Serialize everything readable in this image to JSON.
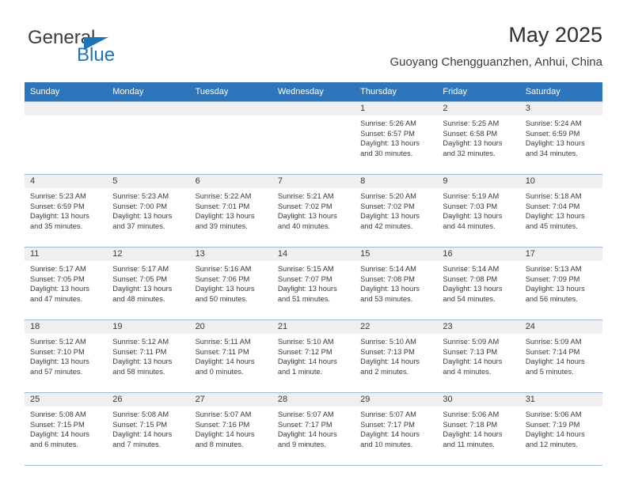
{
  "brand": {
    "name_part1": "General",
    "name_part2": "Blue",
    "logo_icon": "triangle-flag-icon"
  },
  "header": {
    "title": "May 2025",
    "subtitle": "Guoyang Chengguanzhen, Anhui, China"
  },
  "colors": {
    "header_blue": "#2e76bc",
    "brand_blue": "#1f73b7",
    "daynum_bg": "#efefef",
    "grid_line": "#9fb9d4",
    "text": "#3a3a3a"
  },
  "weekdays": [
    "Sunday",
    "Monday",
    "Tuesday",
    "Wednesday",
    "Thursday",
    "Friday",
    "Saturday"
  ],
  "weeks": [
    [
      {
        "day": "",
        "sunrise": "",
        "sunset": "",
        "daylight1": "",
        "daylight2": "",
        "empty": true
      },
      {
        "day": "",
        "sunrise": "",
        "sunset": "",
        "daylight1": "",
        "daylight2": "",
        "empty": true
      },
      {
        "day": "",
        "sunrise": "",
        "sunset": "",
        "daylight1": "",
        "daylight2": "",
        "empty": true
      },
      {
        "day": "",
        "sunrise": "",
        "sunset": "",
        "daylight1": "",
        "daylight2": "",
        "empty": true
      },
      {
        "day": "1",
        "sunrise": "Sunrise: 5:26 AM",
        "sunset": "Sunset: 6:57 PM",
        "daylight1": "Daylight: 13 hours",
        "daylight2": "and 30 minutes.",
        "empty": false
      },
      {
        "day": "2",
        "sunrise": "Sunrise: 5:25 AM",
        "sunset": "Sunset: 6:58 PM",
        "daylight1": "Daylight: 13 hours",
        "daylight2": "and 32 minutes.",
        "empty": false
      },
      {
        "day": "3",
        "sunrise": "Sunrise: 5:24 AM",
        "sunset": "Sunset: 6:59 PM",
        "daylight1": "Daylight: 13 hours",
        "daylight2": "and 34 minutes.",
        "empty": false
      }
    ],
    [
      {
        "day": "4",
        "sunrise": "Sunrise: 5:23 AM",
        "sunset": "Sunset: 6:59 PM",
        "daylight1": "Daylight: 13 hours",
        "daylight2": "and 35 minutes.",
        "empty": false
      },
      {
        "day": "5",
        "sunrise": "Sunrise: 5:23 AM",
        "sunset": "Sunset: 7:00 PM",
        "daylight1": "Daylight: 13 hours",
        "daylight2": "and 37 minutes.",
        "empty": false
      },
      {
        "day": "6",
        "sunrise": "Sunrise: 5:22 AM",
        "sunset": "Sunset: 7:01 PM",
        "daylight1": "Daylight: 13 hours",
        "daylight2": "and 39 minutes.",
        "empty": false
      },
      {
        "day": "7",
        "sunrise": "Sunrise: 5:21 AM",
        "sunset": "Sunset: 7:02 PM",
        "daylight1": "Daylight: 13 hours",
        "daylight2": "and 40 minutes.",
        "empty": false
      },
      {
        "day": "8",
        "sunrise": "Sunrise: 5:20 AM",
        "sunset": "Sunset: 7:02 PM",
        "daylight1": "Daylight: 13 hours",
        "daylight2": "and 42 minutes.",
        "empty": false
      },
      {
        "day": "9",
        "sunrise": "Sunrise: 5:19 AM",
        "sunset": "Sunset: 7:03 PM",
        "daylight1": "Daylight: 13 hours",
        "daylight2": "and 44 minutes.",
        "empty": false
      },
      {
        "day": "10",
        "sunrise": "Sunrise: 5:18 AM",
        "sunset": "Sunset: 7:04 PM",
        "daylight1": "Daylight: 13 hours",
        "daylight2": "and 45 minutes.",
        "empty": false
      }
    ],
    [
      {
        "day": "11",
        "sunrise": "Sunrise: 5:17 AM",
        "sunset": "Sunset: 7:05 PM",
        "daylight1": "Daylight: 13 hours",
        "daylight2": "and 47 minutes.",
        "empty": false
      },
      {
        "day": "12",
        "sunrise": "Sunrise: 5:17 AM",
        "sunset": "Sunset: 7:05 PM",
        "daylight1": "Daylight: 13 hours",
        "daylight2": "and 48 minutes.",
        "empty": false
      },
      {
        "day": "13",
        "sunrise": "Sunrise: 5:16 AM",
        "sunset": "Sunset: 7:06 PM",
        "daylight1": "Daylight: 13 hours",
        "daylight2": "and 50 minutes.",
        "empty": false
      },
      {
        "day": "14",
        "sunrise": "Sunrise: 5:15 AM",
        "sunset": "Sunset: 7:07 PM",
        "daylight1": "Daylight: 13 hours",
        "daylight2": "and 51 minutes.",
        "empty": false
      },
      {
        "day": "15",
        "sunrise": "Sunrise: 5:14 AM",
        "sunset": "Sunset: 7:08 PM",
        "daylight1": "Daylight: 13 hours",
        "daylight2": "and 53 minutes.",
        "empty": false
      },
      {
        "day": "16",
        "sunrise": "Sunrise: 5:14 AM",
        "sunset": "Sunset: 7:08 PM",
        "daylight1": "Daylight: 13 hours",
        "daylight2": "and 54 minutes.",
        "empty": false
      },
      {
        "day": "17",
        "sunrise": "Sunrise: 5:13 AM",
        "sunset": "Sunset: 7:09 PM",
        "daylight1": "Daylight: 13 hours",
        "daylight2": "and 56 minutes.",
        "empty": false
      }
    ],
    [
      {
        "day": "18",
        "sunrise": "Sunrise: 5:12 AM",
        "sunset": "Sunset: 7:10 PM",
        "daylight1": "Daylight: 13 hours",
        "daylight2": "and 57 minutes.",
        "empty": false
      },
      {
        "day": "19",
        "sunrise": "Sunrise: 5:12 AM",
        "sunset": "Sunset: 7:11 PM",
        "daylight1": "Daylight: 13 hours",
        "daylight2": "and 58 minutes.",
        "empty": false
      },
      {
        "day": "20",
        "sunrise": "Sunrise: 5:11 AM",
        "sunset": "Sunset: 7:11 PM",
        "daylight1": "Daylight: 14 hours",
        "daylight2": "and 0 minutes.",
        "empty": false
      },
      {
        "day": "21",
        "sunrise": "Sunrise: 5:10 AM",
        "sunset": "Sunset: 7:12 PM",
        "daylight1": "Daylight: 14 hours",
        "daylight2": "and 1 minute.",
        "empty": false
      },
      {
        "day": "22",
        "sunrise": "Sunrise: 5:10 AM",
        "sunset": "Sunset: 7:13 PM",
        "daylight1": "Daylight: 14 hours",
        "daylight2": "and 2 minutes.",
        "empty": false
      },
      {
        "day": "23",
        "sunrise": "Sunrise: 5:09 AM",
        "sunset": "Sunset: 7:13 PM",
        "daylight1": "Daylight: 14 hours",
        "daylight2": "and 4 minutes.",
        "empty": false
      },
      {
        "day": "24",
        "sunrise": "Sunrise: 5:09 AM",
        "sunset": "Sunset: 7:14 PM",
        "daylight1": "Daylight: 14 hours",
        "daylight2": "and 5 minutes.",
        "empty": false
      }
    ],
    [
      {
        "day": "25",
        "sunrise": "Sunrise: 5:08 AM",
        "sunset": "Sunset: 7:15 PM",
        "daylight1": "Daylight: 14 hours",
        "daylight2": "and 6 minutes.",
        "empty": false
      },
      {
        "day": "26",
        "sunrise": "Sunrise: 5:08 AM",
        "sunset": "Sunset: 7:15 PM",
        "daylight1": "Daylight: 14 hours",
        "daylight2": "and 7 minutes.",
        "empty": false
      },
      {
        "day": "27",
        "sunrise": "Sunrise: 5:07 AM",
        "sunset": "Sunset: 7:16 PM",
        "daylight1": "Daylight: 14 hours",
        "daylight2": "and 8 minutes.",
        "empty": false
      },
      {
        "day": "28",
        "sunrise": "Sunrise: 5:07 AM",
        "sunset": "Sunset: 7:17 PM",
        "daylight1": "Daylight: 14 hours",
        "daylight2": "and 9 minutes.",
        "empty": false
      },
      {
        "day": "29",
        "sunrise": "Sunrise: 5:07 AM",
        "sunset": "Sunset: 7:17 PM",
        "daylight1": "Daylight: 14 hours",
        "daylight2": "and 10 minutes.",
        "empty": false
      },
      {
        "day": "30",
        "sunrise": "Sunrise: 5:06 AM",
        "sunset": "Sunset: 7:18 PM",
        "daylight1": "Daylight: 14 hours",
        "daylight2": "and 11 minutes.",
        "empty": false
      },
      {
        "day": "31",
        "sunrise": "Sunrise: 5:06 AM",
        "sunset": "Sunset: 7:19 PM",
        "daylight1": "Daylight: 14 hours",
        "daylight2": "and 12 minutes.",
        "empty": false
      }
    ]
  ]
}
